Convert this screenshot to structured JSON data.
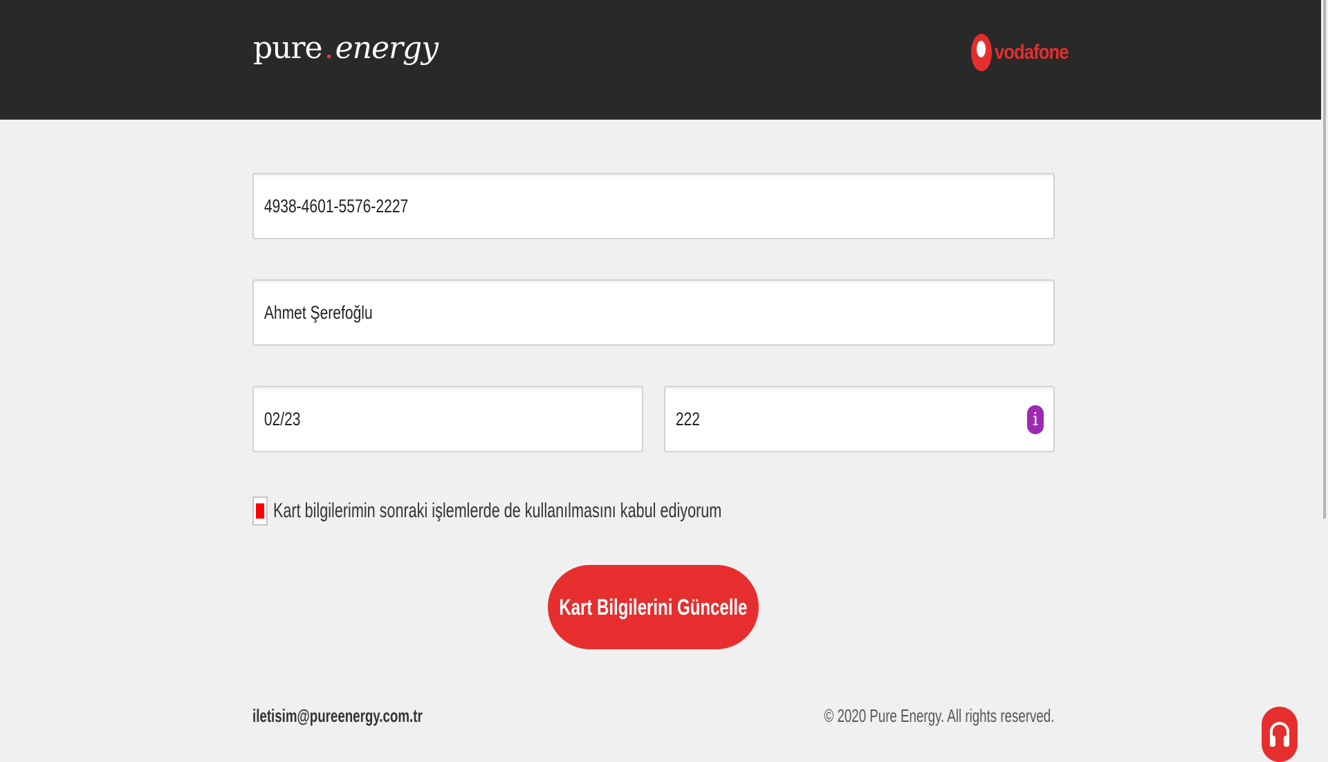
{
  "header": {
    "brand_pure": "pure",
    "brand_dot": ".",
    "brand_energy": "energy",
    "partner": "vodafone"
  },
  "form": {
    "card_number": "4938-4601-5576-2227",
    "card_holder": "Ahmet Şerefoğlu",
    "expiry": "02/23",
    "cvv": "222",
    "info_glyph": "i",
    "consent_label": "Kart bilgilerimin sonraki işlemlerde de kullanılmasını kabul ediyorum",
    "consent_checked": true,
    "submit_label": "Kart Bilgilerini Güncelle"
  },
  "footer": {
    "email": "iletisim@pureenergy.com.tr",
    "copyright": "© 2020 Pure Energy. All rights reserved."
  },
  "icons": {
    "info": "info-icon",
    "support": "headset-icon",
    "partner_logo": "vodafone-logo"
  },
  "colors": {
    "header_bg": "#292929",
    "page_bg": "#f0f0f0",
    "accent": "#e62e2e",
    "info": "#9c2ab3",
    "checkbox_fill": "#ff0000"
  }
}
